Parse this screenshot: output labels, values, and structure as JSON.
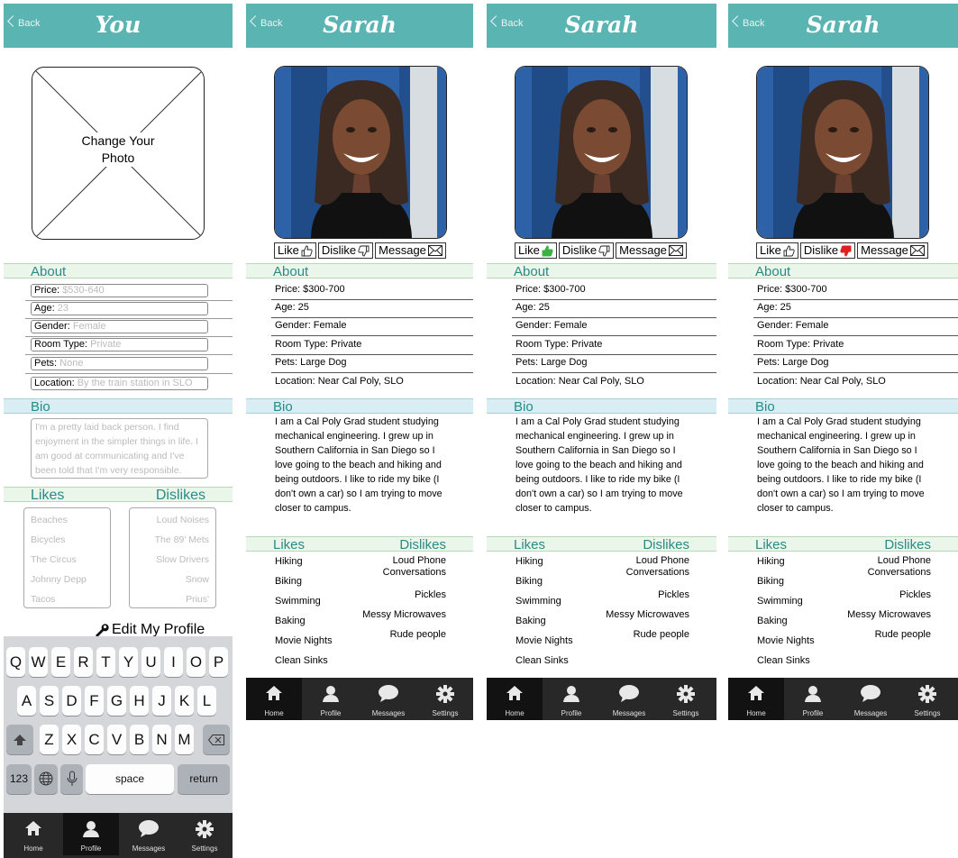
{
  "screens": [
    {
      "back": "Back",
      "title": "You",
      "photo_label": "Change Your Photo",
      "about_title": "About",
      "fields": [
        {
          "label": "Price:",
          "placeholder": "$530-640"
        },
        {
          "label": "Age:",
          "placeholder": "23"
        },
        {
          "label": "Gender:",
          "placeholder": "Female"
        },
        {
          "label": "Room Type:",
          "placeholder": "Private"
        },
        {
          "label": "Pets:",
          "placeholder": "None"
        },
        {
          "label": "Location:",
          "placeholder": "By the train station in SLO"
        }
      ],
      "bio_title": "Bio",
      "bio_placeholder": "I'm a pretty laid back person. I find enjoyment in the simpler things in life. I am good at communicating and I've been told that I'm very responsible.",
      "likes_title": "Likes",
      "dislikes_title": "Dislikes",
      "likes": [
        "Beaches",
        "Bicycles",
        "The Circus",
        "Johnny Depp",
        "Tacos"
      ],
      "dislikes": [
        "Loud Noises",
        "The 89' Mets",
        "Slow Drivers",
        "Snow",
        "Prius'"
      ],
      "edit_label": "Edit My Profile",
      "keyboard": {
        "row1": [
          "Q",
          "W",
          "E",
          "R",
          "T",
          "Y",
          "U",
          "I",
          "O",
          "P"
        ],
        "row2": [
          "A",
          "S",
          "D",
          "F",
          "G",
          "H",
          "J",
          "K",
          "L"
        ],
        "row3": [
          "Z",
          "X",
          "C",
          "V",
          "B",
          "N",
          "M"
        ],
        "numbers": "123",
        "space": "space",
        "return": "return"
      }
    },
    {
      "back": "Back",
      "title": "Sarah",
      "like": "Like",
      "dislike": "Dislike",
      "message": "Message",
      "about_title": "About",
      "fields": [
        "Price: $300-700",
        "Age: 25",
        "Gender: Female",
        "Room Type: Private",
        "Pets: Large Dog",
        "Location: Near Cal Poly, SLO"
      ],
      "bio_title": "Bio",
      "bio": "I am a Cal Poly Grad student studying mechanical engineering. I grew up in Southern California in San Diego so I love going to the beach and hiking and being outdoors. I like to ride my bike (I don't own a car) so I am trying to move closer to campus.",
      "likes_title": "Likes",
      "dislikes_title": "Dislikes",
      "likes": [
        "Hiking",
        "Biking",
        "Swimming",
        "Baking",
        "Movie Nights",
        "Clean Sinks"
      ],
      "dislikes": [
        "Loud Phone Conversations",
        "Pickles",
        "Messy Microwaves",
        "Rude people"
      ],
      "like_state": "neutral",
      "dislike_state": "neutral"
    },
    {
      "back": "Back",
      "title": "Sarah",
      "like": "Like",
      "dislike": "Dislike",
      "message": "Message",
      "about_title": "About",
      "fields": [
        "Price: $300-700",
        "Age: 25",
        "Gender: Female",
        "Room Type: Private",
        "Pets: Large Dog",
        "Location: Near Cal Poly, SLO"
      ],
      "bio_title": "Bio",
      "bio": "I am a Cal Poly Grad student studying mechanical engineering. I grew up in Southern California in San Diego so I love going to the beach and hiking and being outdoors. I like to ride my bike (I don't own a car) so I am trying to move closer to campus.",
      "likes_title": "Likes",
      "dislikes_title": "Dislikes",
      "likes": [
        "Hiking",
        "Biking",
        "Swimming",
        "Baking",
        "Movie Nights",
        "Clean Sinks"
      ],
      "dislikes": [
        "Loud Phone Conversations",
        "Pickles",
        "Messy Microwaves",
        "Rude people"
      ],
      "like_state": "liked",
      "dislike_state": "neutral"
    },
    {
      "back": "Back",
      "title": "Sarah",
      "like": "Like",
      "dislike": "Dislike",
      "message": "Message",
      "about_title": "About",
      "fields": [
        "Price: $300-700",
        "Age: 25",
        "Gender: Female",
        "Room Type: Private",
        "Pets: Large Dog",
        "Location: Near Cal Poly, SLO"
      ],
      "bio_title": "Bio",
      "bio": "I am a Cal Poly Grad student studying mechanical engineering. I grew up in Southern California in San Diego so I love going to the beach and hiking and being outdoors. I like to ride my bike (I don't own a car) so I am trying to move closer to campus.",
      "likes_title": "Likes",
      "dislikes_title": "Dislikes",
      "likes": [
        "Hiking",
        "Biking",
        "Swimming",
        "Baking",
        "Movie Nights",
        "Clean Sinks"
      ],
      "dislikes": [
        "Loud Phone Conversations",
        "Pickles",
        "Messy Microwaves",
        "Rude people"
      ],
      "like_state": "neutral",
      "dislike_state": "disliked"
    }
  ],
  "tabbar": {
    "tabs": [
      {
        "label": "Home",
        "icon": "home-icon"
      },
      {
        "label": "Profile",
        "icon": "profile-icon"
      },
      {
        "label": "Messages",
        "icon": "messages-icon"
      },
      {
        "label": "Settings",
        "icon": "settings-icon"
      }
    ]
  },
  "colors": {
    "nav": "#5ab4b2",
    "section_green": "#eaf6ea",
    "section_blue": "#d6eef4",
    "accent_text": "#2a8a86",
    "tabbar": "#282828",
    "like_active": "#3cb043",
    "dislike_active": "#e02020"
  }
}
